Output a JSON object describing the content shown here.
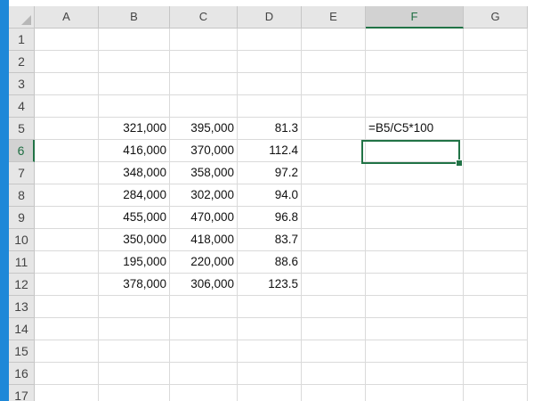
{
  "sheet": {
    "columns": [
      "A",
      "B",
      "C",
      "D",
      "E",
      "F",
      "G"
    ],
    "rows": [
      "1",
      "2",
      "3",
      "4",
      "5",
      "6",
      "7",
      "8",
      "9",
      "10",
      "11",
      "12",
      "13",
      "14",
      "15",
      "16",
      "17"
    ],
    "selected_column": "F",
    "selected_row": "6",
    "active_cell": "F6",
    "cells": {
      "B5": "321,000",
      "C5": "395,000",
      "D5": "81.3",
      "F5": "=B5/C5*100",
      "B6": "416,000",
      "C6": "370,000",
      "D6": "112.4",
      "B7": "348,000",
      "C7": "358,000",
      "D7": "97.2",
      "B8": "284,000",
      "C8": "302,000",
      "D8": "94.0",
      "B9": "455,000",
      "C9": "470,000",
      "D9": "96.8",
      "B10": "350,000",
      "C10": "418,000",
      "D10": "83.7",
      "B11": "195,000",
      "C11": "220,000",
      "D11": "88.6",
      "B12": "378,000",
      "C12": "306,000",
      "D12": "123.5"
    },
    "accent_color": "#217346",
    "window_edge_color": "#1e88d8"
  }
}
